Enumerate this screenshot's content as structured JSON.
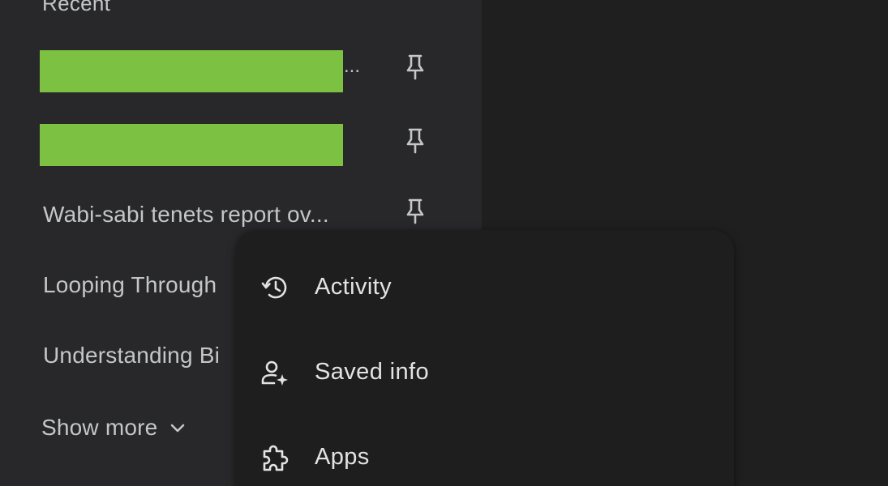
{
  "sidebar": {
    "section_heading": "Recent",
    "recent_items": [
      {
        "title": "",
        "redacted": true,
        "truncated_marker": "...",
        "pin_icon": "pin-icon"
      },
      {
        "title": "",
        "redacted": true,
        "truncated_marker": "",
        "pin_icon": "pin-icon"
      },
      {
        "title": "Wabi-sabi tenets report ov...",
        "redacted": false,
        "pin_icon": "pin-icon"
      },
      {
        "title": "Looping Through",
        "redacted": false
      },
      {
        "title": "Understanding Bi",
        "redacted": false
      }
    ],
    "show_more_label": "Show more",
    "show_more_icon": "chevron-down-icon"
  },
  "menu": {
    "items": [
      {
        "label": "Activity",
        "icon": "history-icon"
      },
      {
        "label": "Saved info",
        "icon": "person-sparkle-icon"
      },
      {
        "label": "Apps",
        "icon": "puzzle-icon"
      }
    ]
  },
  "colors": {
    "background": "#1f1f20",
    "sidebar": "#28282a",
    "menu": "#1e1e1f",
    "text_secondary": "#c4c7c5",
    "text_primary": "#e3e3e3",
    "redaction": "#7dc142"
  }
}
